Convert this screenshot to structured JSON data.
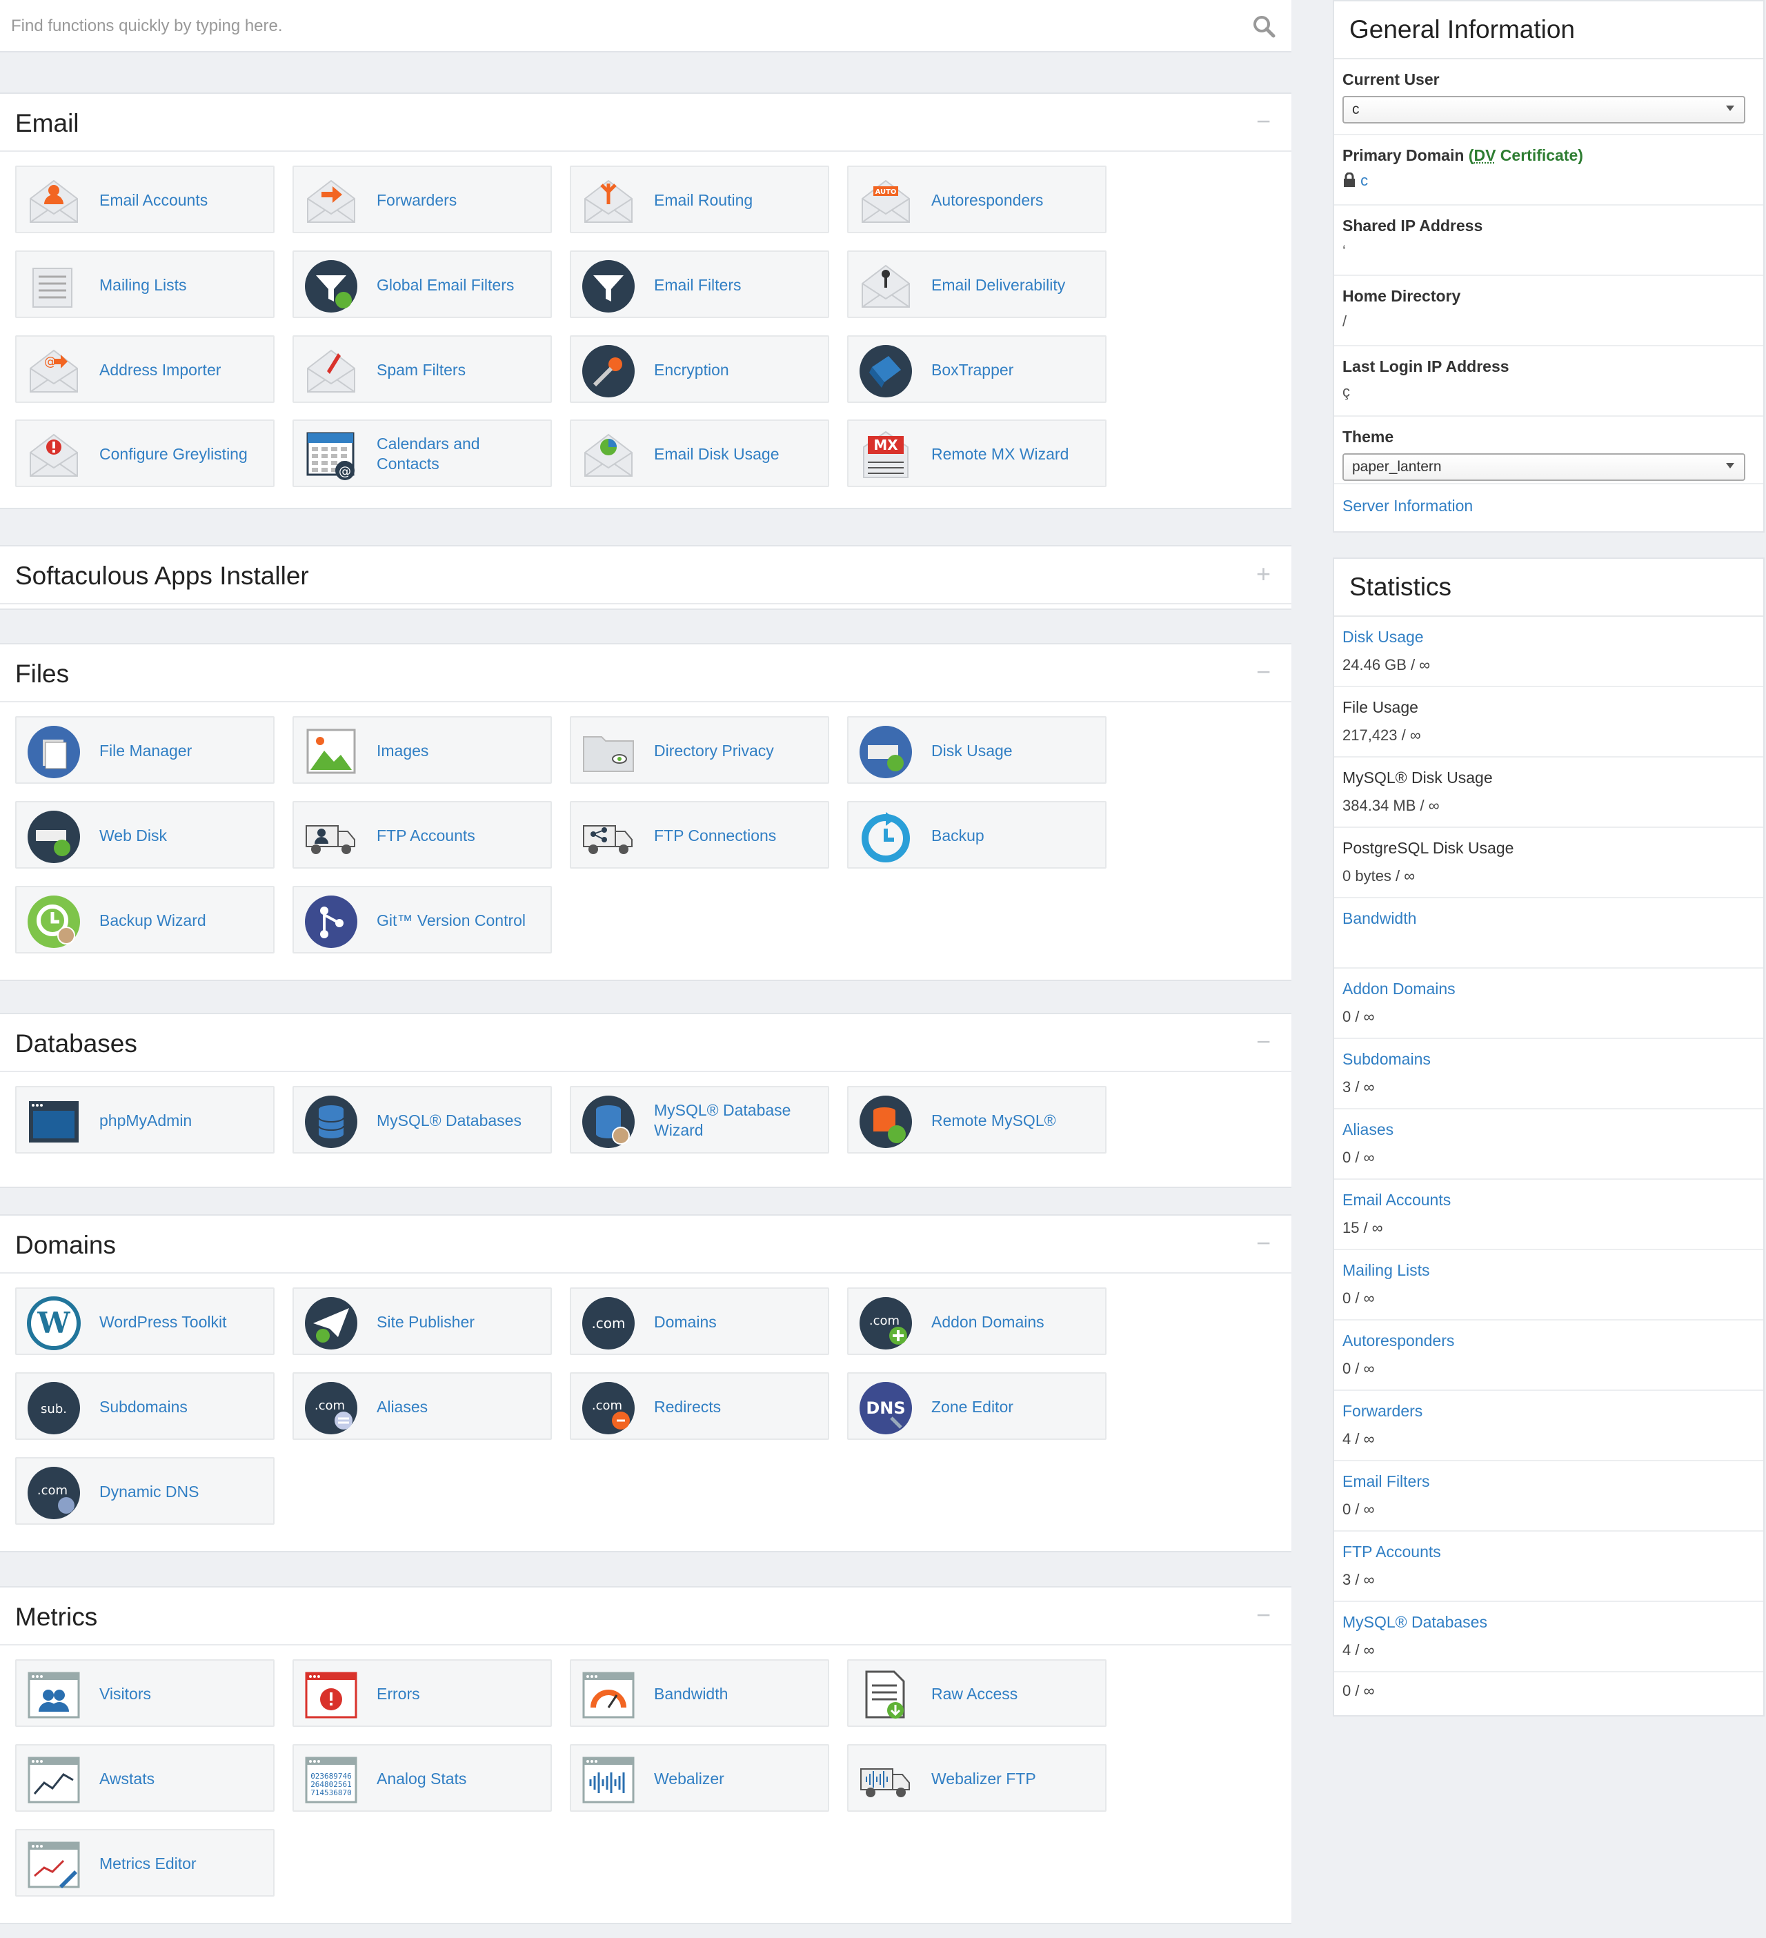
{
  "search": {
    "placeholder": "Find functions quickly by typing here."
  },
  "sections": [
    {
      "title": "Email",
      "toggle": "−",
      "items": [
        {
          "label": "Email Accounts",
          "icon": "email-accounts-icon"
        },
        {
          "label": "Forwarders",
          "icon": "forwarders-icon"
        },
        {
          "label": "Email Routing",
          "icon": "email-routing-icon"
        },
        {
          "label": "Autoresponders",
          "icon": "autoresponders-icon"
        },
        {
          "label": "Mailing Lists",
          "icon": "mailing-lists-icon"
        },
        {
          "label": "Global Email Filters",
          "icon": "global-email-filters-icon"
        },
        {
          "label": "Email Filters",
          "icon": "email-filters-icon"
        },
        {
          "label": "Email Deliverability",
          "icon": "email-deliverability-icon"
        },
        {
          "label": "Address Importer",
          "icon": "address-importer-icon"
        },
        {
          "label": "Spam Filters",
          "icon": "spam-filters-icon"
        },
        {
          "label": "Encryption",
          "icon": "encryption-icon"
        },
        {
          "label": "BoxTrapper",
          "icon": "boxtrapper-icon"
        },
        {
          "label": "Configure Greylisting",
          "icon": "greylisting-icon"
        },
        {
          "label": "Calendars and Contacts",
          "icon": "calendars-icon"
        },
        {
          "label": "Email Disk Usage",
          "icon": "email-disk-usage-icon"
        },
        {
          "label": "Remote MX Wizard",
          "icon": "remote-mx-icon"
        }
      ]
    },
    {
      "title": "Softaculous Apps Installer",
      "toggle": "+",
      "items": []
    },
    {
      "title": "Files",
      "toggle": "−",
      "items": [
        {
          "label": "File Manager",
          "icon": "file-manager-icon"
        },
        {
          "label": "Images",
          "icon": "images-icon"
        },
        {
          "label": "Directory Privacy",
          "icon": "directory-privacy-icon"
        },
        {
          "label": "Disk Usage",
          "icon": "disk-usage-icon"
        },
        {
          "label": "Web Disk",
          "icon": "web-disk-icon"
        },
        {
          "label": "FTP Accounts",
          "icon": "ftp-accounts-icon"
        },
        {
          "label": "FTP Connections",
          "icon": "ftp-connections-icon"
        },
        {
          "label": "Backup",
          "icon": "backup-icon"
        },
        {
          "label": "Backup Wizard",
          "icon": "backup-wizard-icon"
        },
        {
          "label": "Git™ Version Control",
          "icon": "git-icon"
        }
      ]
    },
    {
      "title": "Databases",
      "toggle": "−",
      "items": [
        {
          "label": "phpMyAdmin",
          "icon": "phpmyadmin-icon"
        },
        {
          "label": "MySQL® Databases",
          "icon": "mysql-databases-icon"
        },
        {
          "label": "MySQL® Database Wizard",
          "icon": "mysql-wizard-icon"
        },
        {
          "label": "Remote MySQL®",
          "icon": "remote-mysql-icon"
        }
      ]
    },
    {
      "title": "Domains",
      "toggle": "−",
      "items": [
        {
          "label": "WordPress Toolkit",
          "icon": "wordpress-icon"
        },
        {
          "label": "Site Publisher",
          "icon": "site-publisher-icon"
        },
        {
          "label": "Domains",
          "icon": "domains-icon"
        },
        {
          "label": "Addon Domains",
          "icon": "addon-domains-icon"
        },
        {
          "label": "Subdomains",
          "icon": "subdomains-icon"
        },
        {
          "label": "Aliases",
          "icon": "aliases-icon"
        },
        {
          "label": "Redirects",
          "icon": "redirects-icon"
        },
        {
          "label": "Zone Editor",
          "icon": "zone-editor-icon"
        },
        {
          "label": "Dynamic DNS",
          "icon": "dynamic-dns-icon"
        }
      ]
    },
    {
      "title": "Metrics",
      "toggle": "−",
      "items": [
        {
          "label": "Visitors",
          "icon": "visitors-icon"
        },
        {
          "label": "Errors",
          "icon": "errors-icon"
        },
        {
          "label": "Bandwidth",
          "icon": "bandwidth-icon"
        },
        {
          "label": "Raw Access",
          "icon": "raw-access-icon"
        },
        {
          "label": "Awstats",
          "icon": "awstats-icon"
        },
        {
          "label": "Analog Stats",
          "icon": "analog-stats-icon"
        },
        {
          "label": "Webalizer",
          "icon": "webalizer-icon"
        },
        {
          "label": "Webalizer FTP",
          "icon": "webalizer-ftp-icon"
        },
        {
          "label": "Metrics Editor",
          "icon": "metrics-editor-icon"
        }
      ]
    }
  ],
  "general": {
    "title": "General Information",
    "current_user_label": "Current User",
    "current_user_value": "c",
    "primary_domain_label": "Primary Domain",
    "cert_open": "(",
    "cert_dv": "DV",
    "cert_rest": " Certificate)",
    "primary_domain_value": "c",
    "shared_ip_label": "Shared IP Address",
    "shared_ip_value": "‘",
    "home_dir_label": "Home Directory",
    "home_dir_value": "/",
    "last_login_label": "Last Login IP Address",
    "last_login_value": "ç",
    "theme_label": "Theme",
    "theme_value": "paper_lantern",
    "server_info": "Server Information"
  },
  "statistics": {
    "title": "Statistics",
    "items": [
      {
        "label": "Disk Usage",
        "value": "24.46 GB / ∞",
        "link": true
      },
      {
        "label": "File Usage",
        "value": "217,423 / ∞",
        "link": false
      },
      {
        "label": "MySQL® Disk Usage",
        "value": "384.34 MB / ∞",
        "link": false
      },
      {
        "label": "PostgreSQL Disk Usage",
        "value": "0 bytes / ∞",
        "link": false
      },
      {
        "label": "Bandwidth",
        "value": "",
        "link": true
      },
      {
        "label": "Addon Domains",
        "value": "0 / ∞",
        "link": true
      },
      {
        "label": "Subdomains",
        "value": "3 / ∞",
        "link": true
      },
      {
        "label": "Aliases",
        "value": "0 / ∞",
        "link": true
      },
      {
        "label": "Email Accounts",
        "value": "15 / ∞",
        "link": true
      },
      {
        "label": "Mailing Lists",
        "value": "0 / ∞",
        "link": true
      },
      {
        "label": "Autoresponders",
        "value": "0 / ∞",
        "link": true
      },
      {
        "label": "Forwarders",
        "value": "4 / ∞",
        "link": true
      },
      {
        "label": "Email Filters",
        "value": "0 / ∞",
        "link": true
      },
      {
        "label": "FTP Accounts",
        "value": "3 / ∞",
        "link": true
      },
      {
        "label": "MySQL® Databases",
        "value": "4 / ∞",
        "link": true
      },
      {
        "label": "",
        "value": "0 / ∞",
        "link": false
      }
    ]
  },
  "colors": {
    "link": "#317fc4",
    "dark_circle": "#2c3e50",
    "orange": "#f26522",
    "green": "#2e7d32"
  }
}
